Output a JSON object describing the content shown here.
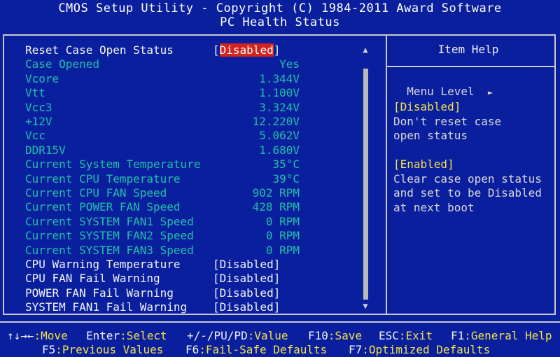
{
  "header": {
    "title": "CMOS Setup Utility - Copyright (C) 1984-2011 Award Software",
    "subtitle": "PC Health Status"
  },
  "settings": [
    {
      "label": "Reset Case Open Status",
      "value": "[Disabled]",
      "type": "option",
      "selected": true
    },
    {
      "label": "Case Opened",
      "value": "Yes",
      "type": "readonly"
    },
    {
      "label": "Vcore",
      "value": "1.344V",
      "type": "readonly"
    },
    {
      "label": "Vtt",
      "value": "1.100V",
      "type": "readonly"
    },
    {
      "label": "Vcc3",
      "value": "3.324V",
      "type": "readonly"
    },
    {
      "label": "+12V",
      "value": "12.220V",
      "type": "readonly"
    },
    {
      "label": "Vcc",
      "value": "5.062V",
      "type": "readonly"
    },
    {
      "label": "DDR15V",
      "value": "1.680V",
      "type": "readonly"
    },
    {
      "label": "Current System Temperature",
      "value": "35°C",
      "type": "readonly"
    },
    {
      "label": "Current CPU Temperature",
      "value": "39°C",
      "type": "readonly"
    },
    {
      "label": "Current CPU FAN Speed",
      "value": "902 RPM",
      "type": "readonly"
    },
    {
      "label": "Current POWER FAN Speed",
      "value": "428 RPM",
      "type": "readonly"
    },
    {
      "label": "Current SYSTEM FAN1 Speed",
      "value": "0 RPM",
      "type": "readonly"
    },
    {
      "label": "Current SYSTEM FAN2 Speed",
      "value": "0 RPM",
      "type": "readonly"
    },
    {
      "label": "Current SYSTEM FAN3 Speed",
      "value": "0 RPM",
      "type": "readonly"
    },
    {
      "label": "CPU Warning Temperature",
      "value": "[Disabled]",
      "type": "option"
    },
    {
      "label": "CPU FAN Fail Warning",
      "value": "[Disabled]",
      "type": "option"
    },
    {
      "label": "POWER FAN Fail Warning",
      "value": "[Disabled]",
      "type": "option"
    },
    {
      "label": "SYSTEM FAN1 Fail Warning",
      "value": "[Disabled]",
      "type": "option"
    }
  ],
  "scroll": {
    "up": "▲",
    "down": "▼"
  },
  "help": {
    "title": "Item Help",
    "menu_level": "Menu Level",
    "menu_level_arrow": "►",
    "lines": [
      {
        "text": "[Disabled]",
        "style": "y"
      },
      {
        "text": "Don't reset case",
        "style": "n"
      },
      {
        "text": "open status",
        "style": "n"
      },
      {
        "text": "",
        "style": "n"
      },
      {
        "text": "[Enabled]",
        "style": "y"
      },
      {
        "text": "Clear case open status",
        "style": "n"
      },
      {
        "text": "and set to be Disabled",
        "style": "n"
      },
      {
        "text": "at next boot",
        "style": "n"
      }
    ]
  },
  "footer": {
    "row1": [
      {
        "key": "↑↓→←",
        "desc": ":Move"
      },
      {
        "key": "Enter",
        "desc": ":Select"
      },
      {
        "key": "+/-/PU/PD",
        "desc": ":Value"
      },
      {
        "key": "F10",
        "desc": ":Save"
      },
      {
        "key": "ESC",
        "desc": ":Exit"
      },
      {
        "key": "F1",
        "desc": ":General Help"
      }
    ],
    "row2": [
      {
        "key": "F5",
        "desc": ":Previous Values"
      },
      {
        "key": "F6",
        "desc": ":Fail-Safe Defaults"
      },
      {
        "key": "F7",
        "desc": ":Optimized Defaults"
      }
    ]
  }
}
